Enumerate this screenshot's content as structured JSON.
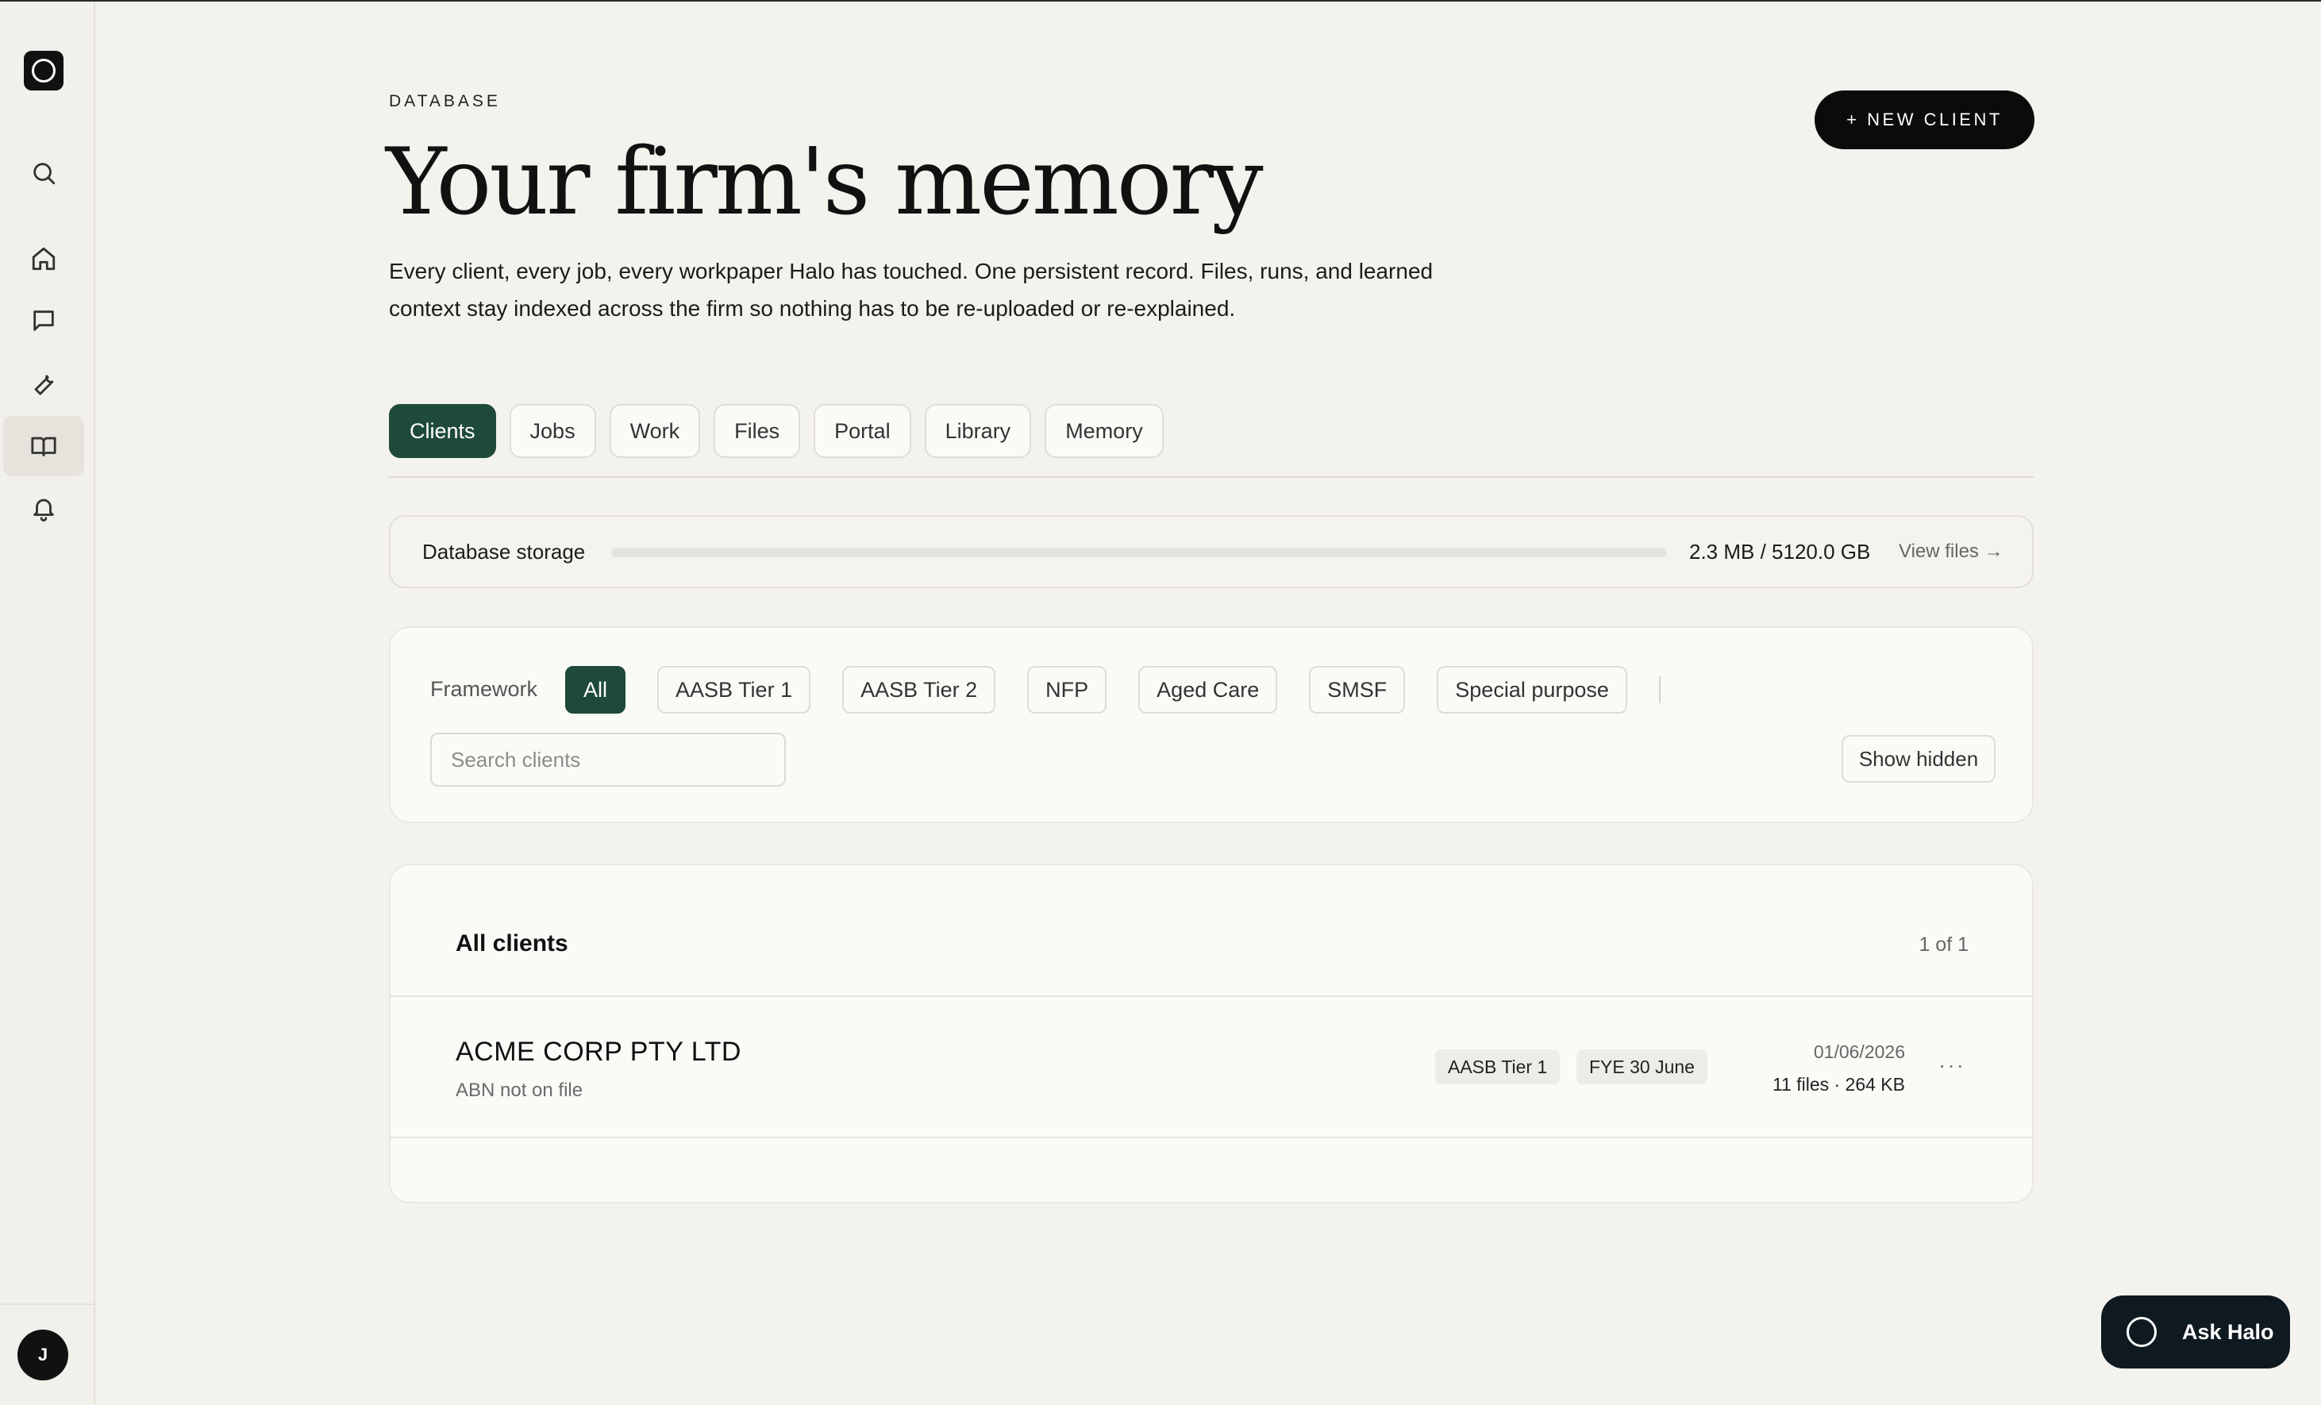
{
  "sidebar": {
    "nav": [
      {
        "name": "search",
        "icon": "search-icon"
      },
      {
        "name": "home",
        "icon": "home-icon"
      },
      {
        "name": "chat",
        "icon": "chat-icon"
      },
      {
        "name": "tools",
        "icon": "wrench-icon"
      },
      {
        "name": "database",
        "icon": "book-open-icon",
        "active": true
      },
      {
        "name": "notifications",
        "icon": "bell-icon"
      }
    ],
    "avatar_initial": "J"
  },
  "header": {
    "eyebrow": "DATABASE",
    "title": "Your firm's memory",
    "description": "Every client, every job, every workpaper Halo has touched. One persistent record. Files, runs, and learned context stay indexed across the firm so nothing has to be re-uploaded or re-explained.",
    "new_client_label": "+ NEW CLIENT"
  },
  "tabs": [
    {
      "label": "Clients",
      "active": true
    },
    {
      "label": "Jobs"
    },
    {
      "label": "Work"
    },
    {
      "label": "Files"
    },
    {
      "label": "Portal"
    },
    {
      "label": "Library"
    },
    {
      "label": "Memory"
    }
  ],
  "storage": {
    "label": "Database storage",
    "value": "2.3 MB / 5120.0 GB",
    "used_fraction": 4e-07,
    "view_files_label": "View files →"
  },
  "filters": {
    "framework_label": "Framework",
    "chips": [
      {
        "label": "All",
        "active": true
      },
      {
        "label": "AASB Tier 1"
      },
      {
        "label": "AASB Tier 2"
      },
      {
        "label": "NFP"
      },
      {
        "label": "Aged Care"
      },
      {
        "label": "SMSF"
      },
      {
        "label": "Special purpose"
      }
    ],
    "search_placeholder": "Search clients",
    "show_hidden_label": "Show hidden"
  },
  "clients": {
    "title": "All clients",
    "count": "1 of 1",
    "rows": [
      {
        "name": "ACME CORP PTY LTD",
        "abn": "ABN not on file",
        "tags": [
          "AASB Tier 1",
          "FYE 30 June"
        ],
        "date": "01/06/2026",
        "meta": "11 files · 264 KB",
        "more": "···"
      }
    ]
  },
  "ask_halo": {
    "label": "Ask Halo"
  },
  "colors": {
    "accent": "#1f4a3a",
    "background": "#f4f2ed",
    "dark": "#0b0b0b"
  }
}
